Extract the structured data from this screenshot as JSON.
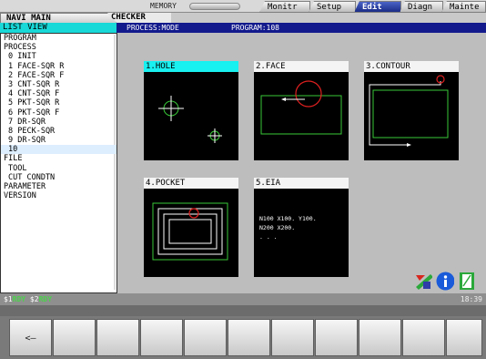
{
  "header": {
    "memory": "MEMORY",
    "tabs": [
      {
        "label": "Monitr",
        "active": false
      },
      {
        "label": "Setup",
        "active": false
      },
      {
        "label": "Edit",
        "active": true
      },
      {
        "label": "Diagn",
        "active": false
      },
      {
        "label": "Mainte",
        "active": false
      }
    ],
    "navi_main": "NAVI MAIN",
    "checker": "CHECKER"
  },
  "titlebar": {
    "list_view": "LIST VIEW",
    "process": "PROCESS:MODE",
    "program": "PROGRAM:108"
  },
  "list": [
    {
      "label": "PROGRAM",
      "level": 0
    },
    {
      "label": "PROCESS",
      "level": 0
    },
    {
      "label": "0 INIT",
      "level": 1
    },
    {
      "label": "1 FACE-SQR R",
      "level": 1
    },
    {
      "label": "2 FACE-SQR F",
      "level": 1
    },
    {
      "label": "3 CNT-SQR R",
      "level": 1
    },
    {
      "label": "4 CNT-SQR F",
      "level": 1
    },
    {
      "label": "5 PKT-SQR R",
      "level": 1
    },
    {
      "label": "6 PKT-SQR F",
      "level": 1
    },
    {
      "label": "7 DR-SQR",
      "level": 1
    },
    {
      "label": "8 PECK-SQR",
      "level": 1
    },
    {
      "label": "9 DR-SQR",
      "level": 1
    },
    {
      "label": "10",
      "level": 1,
      "selected": true
    },
    {
      "label": "FILE",
      "level": 0
    },
    {
      "label": "TOOL",
      "level": 2
    },
    {
      "label": "CUT CONDTN",
      "level": 2
    },
    {
      "label": "PARAMETER",
      "level": 0
    },
    {
      "label": "VERSION",
      "level": 0
    }
  ],
  "panels": [
    {
      "label": "1.HOLE",
      "active": true
    },
    {
      "label": "2.FACE",
      "active": false
    },
    {
      "label": "3.CONTOUR",
      "active": false
    },
    {
      "label": "4.POCKET",
      "active": false
    },
    {
      "label": "5.EIA",
      "active": false
    }
  ],
  "eia_lines": [
    "N100 X100. Y100.",
    "N200 X200.",
    ". . ."
  ],
  "status": {
    "s1_label": "$1",
    "s1_state": "RDY",
    "s2_label": "$2",
    "s2_state": "RDY",
    "time": "18:39"
  },
  "menu": {
    "keys": [
      "<—",
      "",
      "",
      "",
      "",
      "",
      "",
      "",
      "",
      "",
      ""
    ]
  },
  "icons": [
    "tool-icon",
    "info-icon",
    "bookmark-icon"
  ],
  "colors": {
    "active_tab": "#1c2c86",
    "title_bar": "#121a8c",
    "highlight": "#19f0f0",
    "drawing_green": "#38c838",
    "drawing_red": "#e02020"
  }
}
